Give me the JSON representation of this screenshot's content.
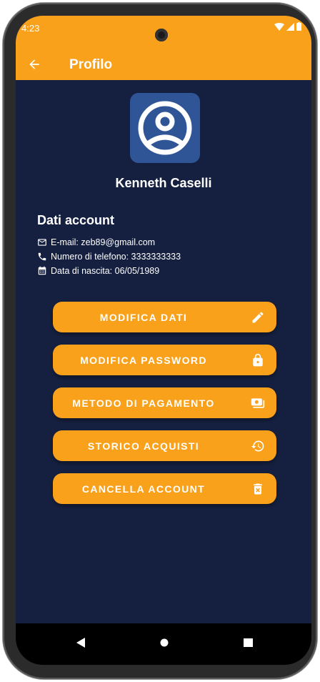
{
  "status_bar": {
    "time": "4:23"
  },
  "app_bar": {
    "title": "Profilo"
  },
  "profile": {
    "name": "Kenneth Caselli"
  },
  "account_section": {
    "title": "Dati account",
    "email": "E-mail: zeb89@gmail.com",
    "phone": "Numero di telefono: 3333333333",
    "birth_date": "Data di nascita: 06/05/1989"
  },
  "actions": {
    "edit_data": "MODIFICA DATI",
    "edit_password": "MODIFICA PASSWORD",
    "payment_method": "METODO DI PAGAMENTO",
    "purchase_history": "STORICO ACQUISTI",
    "delete_account": "CANCELLA ACCOUNT"
  },
  "colors": {
    "accent": "#F9A11B",
    "background": "#152040",
    "avatar_bg": "#2F5597",
    "text": "#FFFFFF"
  },
  "icons": {
    "back": "arrow-left-icon",
    "avatar": "account-circle-icon",
    "email": "mail-icon",
    "phone": "phone-icon",
    "birth_date": "calendar-icon",
    "edit_data": "pencil-icon",
    "edit_password": "lock-icon",
    "payment_method": "payment-icon",
    "purchase_history": "history-icon",
    "delete_account": "trash-icon"
  }
}
